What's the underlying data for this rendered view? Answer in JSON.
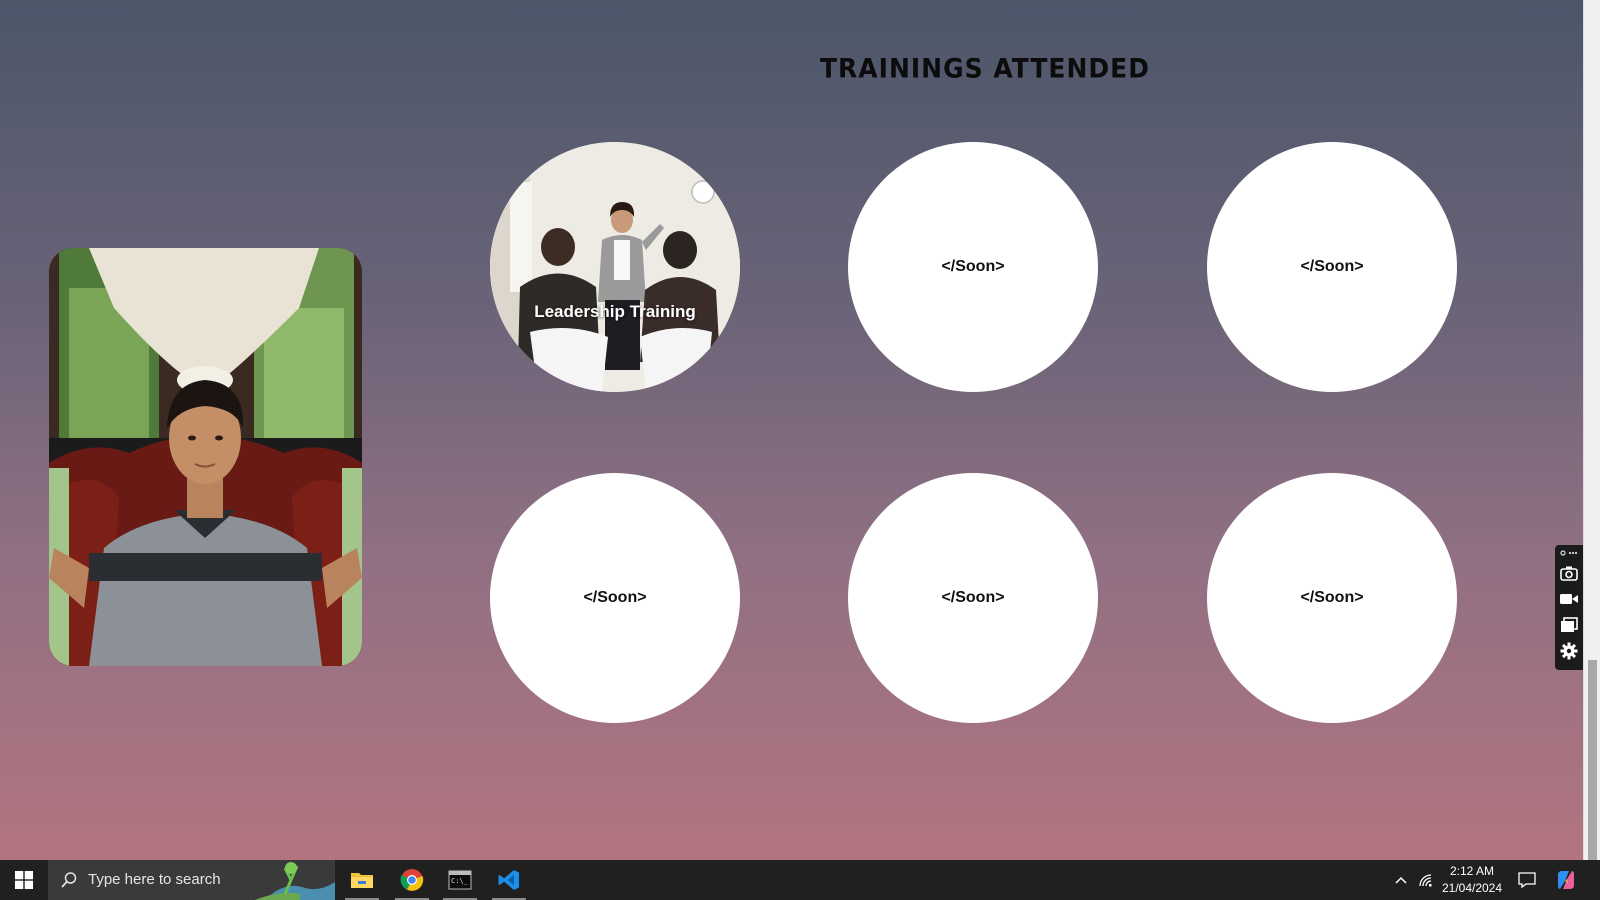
{
  "page": {
    "section_title": "TRAININGS ATTENDED"
  },
  "profile": {
    "photo_icon": "person-photo"
  },
  "trainings": [
    {
      "label": "Leadership Training",
      "has_image": true
    },
    {
      "label": "</Soon>",
      "has_image": false
    },
    {
      "label": "</Soon>",
      "has_image": false
    },
    {
      "label": "</Soon>",
      "has_image": false
    },
    {
      "label": "</Soon>",
      "has_image": false
    },
    {
      "label": "</Soon>",
      "has_image": false
    }
  ],
  "capture_toolbar": {
    "tools": [
      "camera-icon",
      "video-icon",
      "window-icon",
      "gear-icon"
    ]
  },
  "taskbar": {
    "search_placeholder": "Type here to search",
    "apps": [
      "file-explorer-icon",
      "chrome-icon",
      "terminal-icon",
      "vscode-icon"
    ],
    "clock_time": "2:12 AM",
    "clock_date": "21/04/2024"
  },
  "colors": {
    "bg_top": "#4c5669",
    "bg_bottom": "#b2747f",
    "circle": "#ffffff",
    "taskbar": "#202020"
  }
}
